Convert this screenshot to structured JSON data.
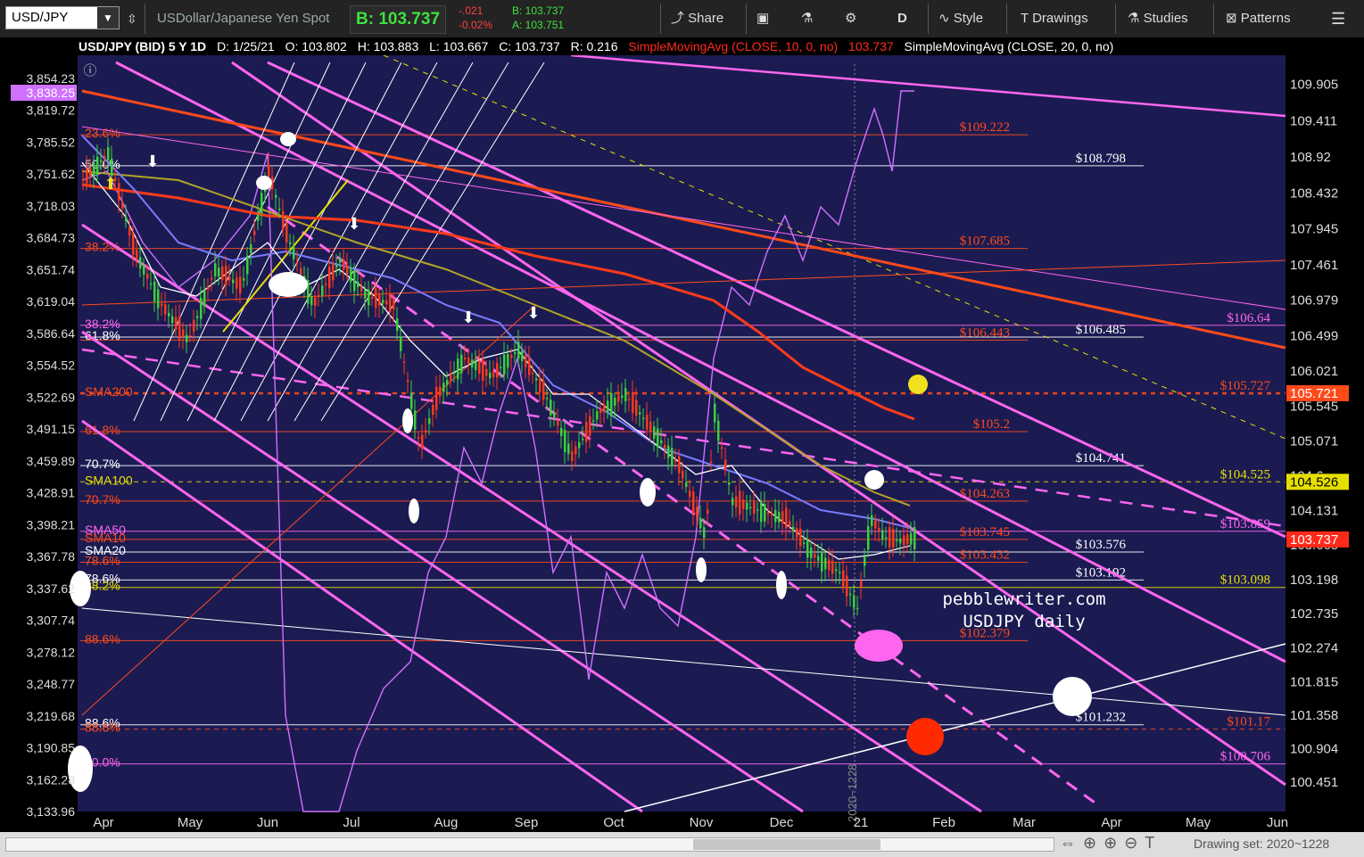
{
  "toolbar": {
    "symbol": "USD/JPY",
    "description": "USDollar/Japanese Yen Spot",
    "bid": "B: 103.737",
    "change": "-.021",
    "change_pct": "-0.02%",
    "bid_small": "B: 103.737",
    "ask_small": "A: 103.751",
    "share": "Share",
    "period": "D",
    "style": "Style",
    "drawings": "Drawings",
    "studies": "Studies",
    "patterns": "Patterns"
  },
  "status": {
    "title": "USD/JPY (BID) 5 Y 1D",
    "date": "D: 1/25/21",
    "open": "O: 103.802",
    "high": "H: 103.883",
    "low": "L: 103.667",
    "close": "C: 103.737",
    "range": "R: 0.216",
    "sma10": "SimpleMovingAvg (CLOSE, 10, 0, no)",
    "sma10_value": "103.737",
    "sma20": "SimpleMovingAvg (CLOSE, 20, 0, no)"
  },
  "footer": {
    "drawing_set": "Drawing set: 2020~1228"
  },
  "chart_data": {
    "type": "candlestick",
    "left_axis_ticks": [
      "3,854.23",
      "3,819.72",
      "3,785.52",
      "3,751.62",
      "3,718.03",
      "3,684.73",
      "3,651.74",
      "3,619.04",
      "3,586.64",
      "3,554.52",
      "3,522.69",
      "3,491.15",
      "3,459.89",
      "3,428.91",
      "3,398.21",
      "3,367.78",
      "3,337.62",
      "3,307.74",
      "3,278.12",
      "3,248.77",
      "3,219.68",
      "3,190.85",
      "3,162.28",
      "3,133.96"
    ],
    "left_axis_marker": "3,838.25",
    "right_axis_ticks": [
      "109.905",
      "109.411",
      "108.92",
      "108.432",
      "107.945",
      "107.461",
      "106.979",
      "106.499",
      "106.021",
      "105.545",
      "105.071",
      "104.6",
      "104.131",
      "103.665",
      "103.198",
      "102.735",
      "102.274",
      "101.815",
      "101.358",
      "100.904",
      "100.451"
    ],
    "right_axis_flags": [
      {
        "text": "105.721",
        "color": "#ff4a1a"
      },
      {
        "text": "104.526",
        "color": "#e6e000"
      },
      {
        "text": "103.737",
        "color": "#ff2a1a"
      }
    ],
    "x_ticks": [
      "Apr",
      "May",
      "Jun",
      "Jul",
      "Aug",
      "Sep",
      "Oct",
      "Nov",
      "Dec",
      "21",
      "Feb",
      "Mar",
      "Apr",
      "May",
      "Jun"
    ],
    "ylim": [
      100.2,
      110.2
    ],
    "levels": [
      {
        "value": 109.22,
        "label": "$109.222",
        "color": "#ff4a1a"
      },
      {
        "value": 108.8,
        "label": "$108.798",
        "color": "#ffffff"
      },
      {
        "value": 107.68,
        "label": "$107.685",
        "color": "#ff4a1a"
      },
      {
        "value": 106.64,
        "label": "$106.64",
        "color": "#ff66ee"
      },
      {
        "value": 106.48,
        "label": "$106.485",
        "color": "#ffffff"
      },
      {
        "value": 106.44,
        "label": "$106.443",
        "color": "#ff4a1a"
      },
      {
        "value": 105.72,
        "label": "$105.727",
        "color": "#ff4a1a"
      },
      {
        "value": 105.2,
        "label": "$105.2",
        "color": "#ff4a1a"
      },
      {
        "value": 104.74,
        "label": "$104.741",
        "color": "#ffffff"
      },
      {
        "value": 104.52,
        "label": "$104.525",
        "color": "#e6e000"
      },
      {
        "value": 104.26,
        "label": "$104.263",
        "color": "#ff4a1a"
      },
      {
        "value": 103.85,
        "label": "$103.859",
        "color": "#ff66ee"
      },
      {
        "value": 103.74,
        "label": "$103.745",
        "color": "#ff4a1a"
      },
      {
        "value": 103.57,
        "label": "$103.576",
        "color": "#ffffff"
      },
      {
        "value": 103.43,
        "label": "$103.432",
        "color": "#ff4a1a"
      },
      {
        "value": 103.19,
        "label": "$103.192",
        "color": "#ffffff"
      },
      {
        "value": 103.09,
        "label": "$103.098",
        "color": "#e6e000"
      },
      {
        "value": 102.37,
        "label": "$102.379",
        "color": "#ff4a1a"
      },
      {
        "value": 101.23,
        "label": "$101.232",
        "color": "#ffffff"
      },
      {
        "value": 101.17,
        "label": "$101.17",
        "color": "#ff4a1a"
      },
      {
        "value": 100.7,
        "label": "$100.706",
        "color": "#ff66ee"
      }
    ],
    "left_labels": [
      {
        "text": "23.6%",
        "color": "#ff4a1a"
      },
      {
        "text": "50.0%",
        "color": "#ffffff"
      },
      {
        "text": "38.2%",
        "color": "#ff4a1a"
      },
      {
        "text": "38.2%",
        "color": "#ff66ee"
      },
      {
        "text": "61.8%",
        "color": "#ffffff"
      },
      {
        "text": "SMA200",
        "color": "#ff4a1a"
      },
      {
        "text": "61.8%",
        "color": "#ff4a1a"
      },
      {
        "text": "70.7%",
        "color": "#ffffff"
      },
      {
        "text": "SMA100",
        "color": "#e6e000"
      },
      {
        "text": "70.7%",
        "color": "#ff4a1a"
      },
      {
        "text": "SMA50",
        "color": "#ff66ee"
      },
      {
        "text": "SMA10",
        "color": "#ff4a1a"
      },
      {
        "text": "SMA20",
        "color": "#ffffff"
      },
      {
        "text": "78.6%",
        "color": "#ff4a1a"
      },
      {
        "text": "78.6%",
        "color": "#ffffff"
      },
      {
        "text": "38.2%",
        "color": "#e6e000"
      },
      {
        "text": "88.6%",
        "color": "#ff4a1a"
      },
      {
        "text": "88.6%",
        "color": "#ffffff"
      },
      {
        "text": "88.6%",
        "color": "#ff4a1a"
      },
      {
        "text": "50.0%",
        "color": "#ff66ee"
      }
    ],
    "annotation": [
      "pebblewriter.com",
      "USDJPY daily"
    ],
    "vertical_marker": "2020~1228",
    "colors": {
      "background": "#1b1b52",
      "up": "#3bd13b",
      "down": "#ff3a1a",
      "sma200": "#ff3a1a",
      "sma100": "#b2a426",
      "sma50": "#7b7bff",
      "sma20": "#ffffff",
      "sma10": "#ff3a1a",
      "channel": "#ff66ee",
      "spx": "#d070ff"
    }
  }
}
